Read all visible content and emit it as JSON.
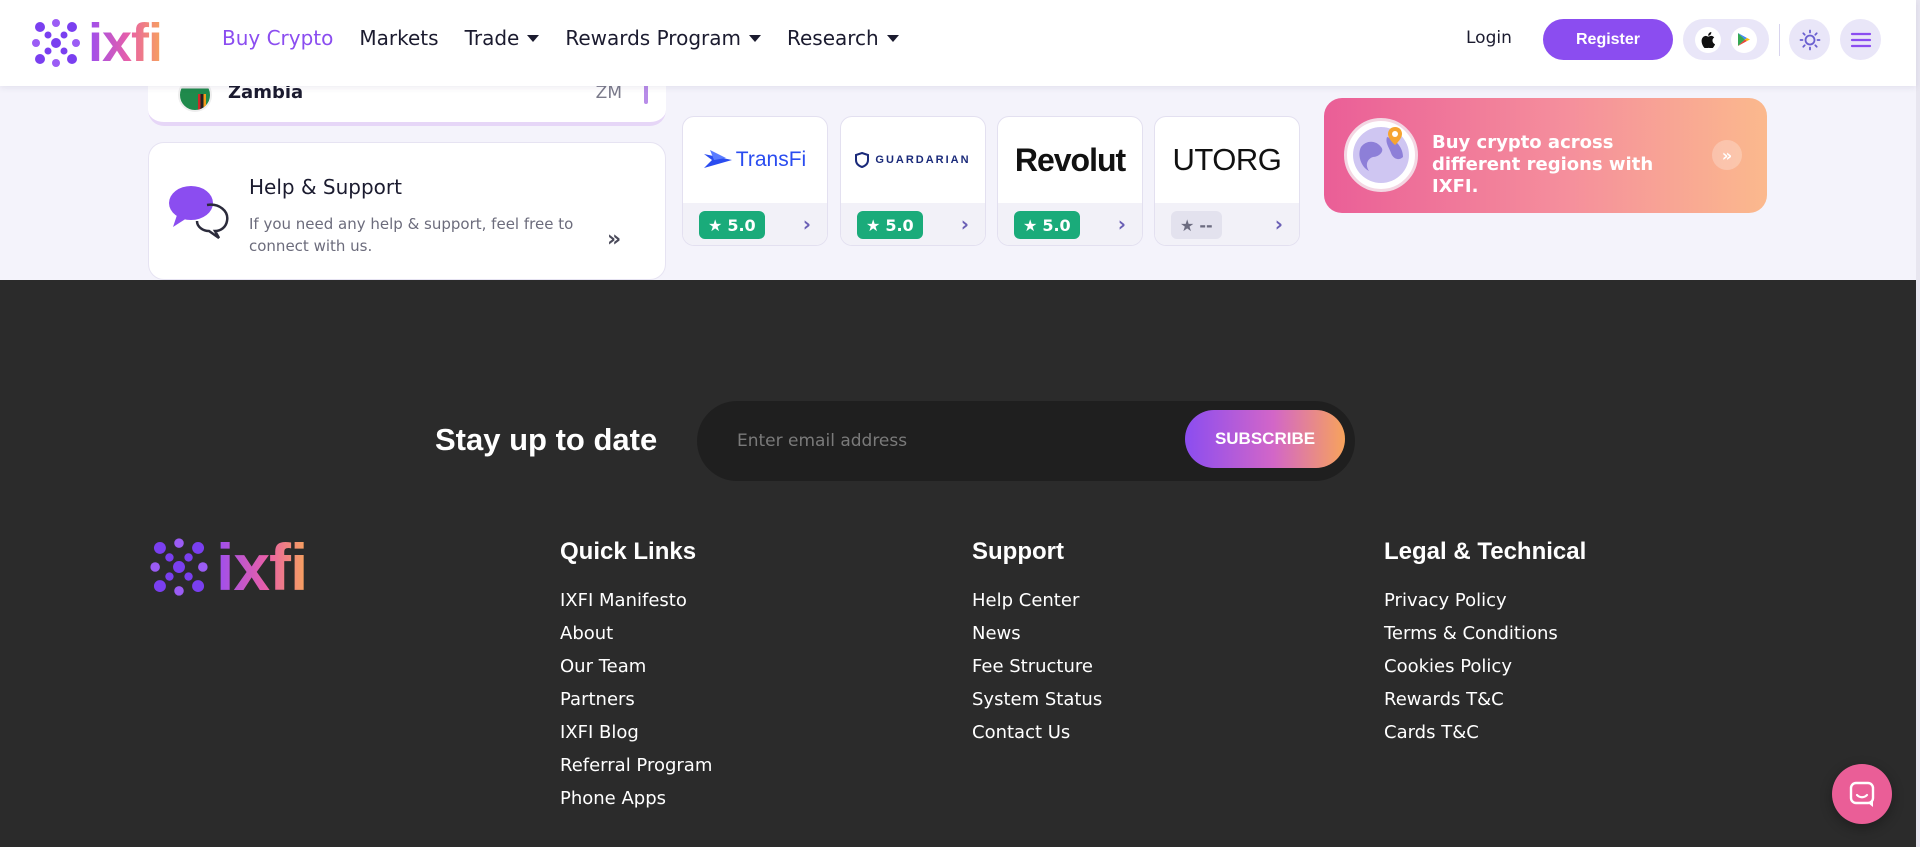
{
  "nav": {
    "logo": "ixfi",
    "links": [
      {
        "label": "Buy Crypto",
        "active": true,
        "dropdown": false
      },
      {
        "label": "Markets",
        "active": false,
        "dropdown": false
      },
      {
        "label": "Trade",
        "active": false,
        "dropdown": true
      },
      {
        "label": "Rewards Program",
        "active": false,
        "dropdown": true
      },
      {
        "label": "Research",
        "active": false,
        "dropdown": true
      }
    ],
    "login": "Login",
    "register": "Register"
  },
  "country": {
    "name": "Zambia",
    "code": "ZM"
  },
  "help": {
    "title": "Help & Support",
    "description": "If you need any help & support, feel free to connect with us."
  },
  "providers": [
    {
      "name": "TransFi",
      "rating": "5.0"
    },
    {
      "name": "GUARDARIAN",
      "rating": "5.0"
    },
    {
      "name": "Revolut",
      "rating": "5.0"
    },
    {
      "name": "UTORG",
      "rating": "--"
    }
  ],
  "promo": {
    "text": "Buy crypto across different regions with IXFI."
  },
  "subscribe": {
    "title": "Stay up to date",
    "placeholder": "Enter email address",
    "button": "SUBSCRIBE"
  },
  "footer": {
    "logo": "ixfi",
    "columns": [
      {
        "title": "Quick Links",
        "links": [
          "IXFI Manifesto",
          "About",
          "Our Team",
          "Partners",
          "IXFI Blog",
          "Referral Program",
          "Phone Apps"
        ]
      },
      {
        "title": "Support",
        "links": [
          "Help Center",
          "News",
          "Fee Structure",
          "System Status",
          "Contact Us"
        ]
      },
      {
        "title": "Legal & Technical",
        "links": [
          "Privacy Policy",
          "Terms & Conditions",
          "Cookies Policy",
          "Rewards T&C",
          "Cards T&C"
        ]
      }
    ]
  },
  "colors": {
    "accent": "#8b4df0",
    "rating_green": "#1aab7a",
    "footer_bg": "#2b2b2b",
    "promo_pink": "#ea5e97"
  }
}
